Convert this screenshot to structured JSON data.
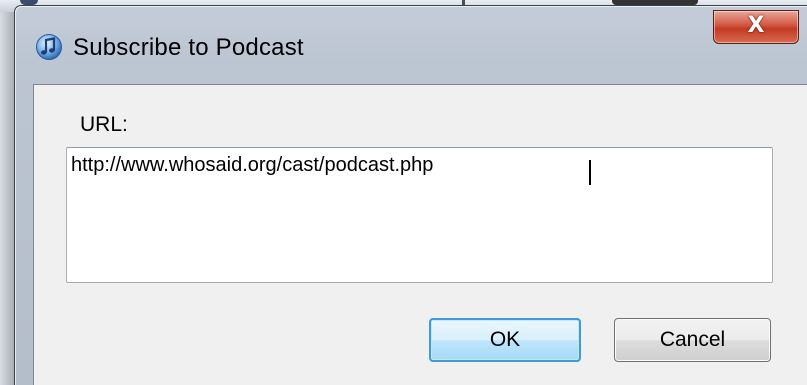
{
  "dialog": {
    "title": "Subscribe to Podcast",
    "app_icon": "itunes-icon",
    "close_icon": "close-icon",
    "close_glyph": "X"
  },
  "form": {
    "url_label": "URL:",
    "url_value": "http://www.whosaid.org/cast/podcast.php"
  },
  "buttons": {
    "ok_label": "OK",
    "cancel_label": "Cancel"
  },
  "colors": {
    "close_button": "#c94a30",
    "ok_border": "#3e9ad8"
  }
}
